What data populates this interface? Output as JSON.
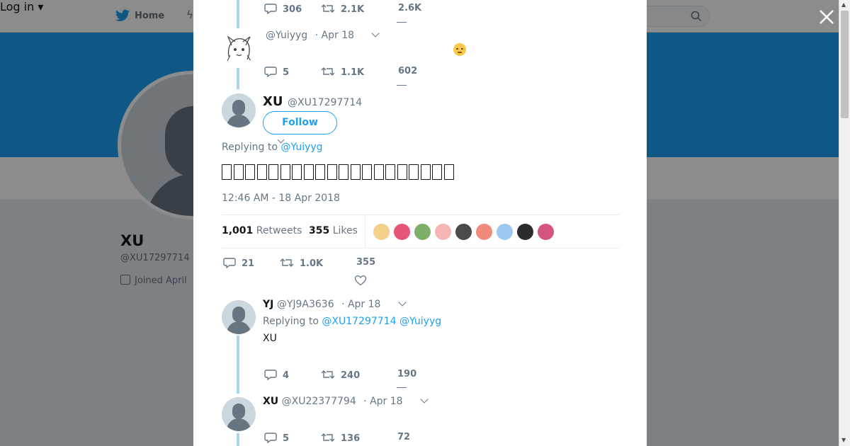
{
  "background": {
    "nav": {
      "home_label": "Home",
      "login_label": "Log in ▾"
    },
    "profile": {
      "name": "XU",
      "handle": "@XU17297714",
      "joined": "Joined April"
    }
  },
  "modal": {
    "thread_top": {
      "actions": {
        "replies": "306",
        "retweets": "2.1K",
        "likes": "2.6K"
      }
    },
    "yuiyyg_tweet": {
      "handle": "@Yuiyyg",
      "date": "· Apr 18",
      "actions": {
        "replies": "5",
        "retweets": "1.1K",
        "likes": "602"
      }
    },
    "main_tweet": {
      "name": "XU",
      "handle": "@XU17297714",
      "follow_label": "Follow",
      "replying_prefix": "Replying to",
      "replying_to": "@Yuiyyg",
      "glyph_count": 20,
      "timestamp": "12:46 AM - 18 Apr 2018",
      "retweets_count": "1,001",
      "retweets_label": "Retweets",
      "likes_count": "355",
      "likes_label": "Likes",
      "liker_colors": [
        "#f3d18a",
        "#e8557a",
        "#7fae6b",
        "#f5b5b5",
        "#4a4a4a",
        "#f08a7a",
        "#9fc8ef",
        "#2c2c2c",
        "#d6557f"
      ],
      "actions": {
        "replies": "21",
        "retweets": "1.0K",
        "likes": "355"
      }
    },
    "yj_reply": {
      "name": "YJ",
      "handle": "@YJ9A3636",
      "date": "· Apr 18",
      "replying_prefix": "Replying to",
      "replying_to_1": "@XU17297714",
      "replying_to_2": "@Yuiyyg",
      "text": "XU",
      "actions": {
        "replies": "4",
        "retweets": "240",
        "likes": "190"
      }
    },
    "xu2_reply": {
      "name": "XU",
      "handle": "@XU22377794",
      "date": "· Apr 18",
      "actions": {
        "replies": "5",
        "retweets": "136",
        "likes": "72"
      }
    }
  }
}
